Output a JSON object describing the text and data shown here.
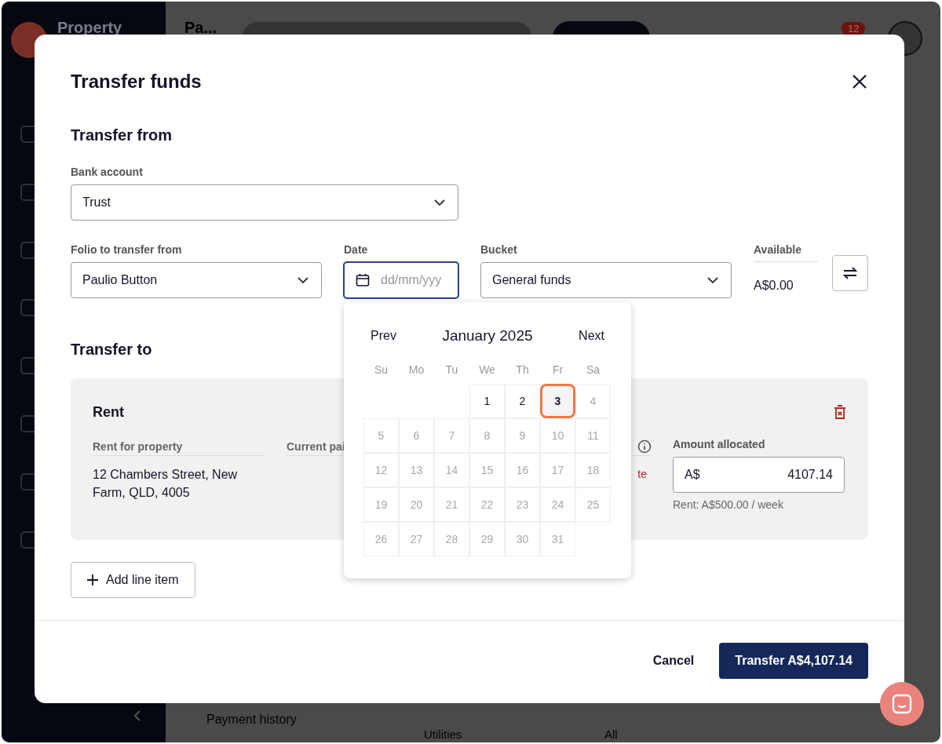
{
  "app": {
    "brand": "Property",
    "page_title": "Pa...",
    "notification_count": "12",
    "background_tab": "Payment history",
    "background_row": [
      "Utilities",
      "All"
    ]
  },
  "modal": {
    "title": "Transfer funds",
    "from": {
      "heading": "Transfer from",
      "bank_account": {
        "label": "Bank account",
        "value": "Trust"
      },
      "folio": {
        "label": "Folio to transfer from",
        "value": "Paulio Button"
      },
      "date": {
        "label": "Date",
        "placeholder": "dd/mm/yyy",
        "focused": true
      },
      "bucket": {
        "label": "Bucket",
        "value": "General funds"
      },
      "available": {
        "label": "Available",
        "value": "A$0.00"
      }
    },
    "to": {
      "heading": "Transfer to",
      "line_items": [
        {
          "title": "Rent",
          "property": {
            "label": "Rent for property",
            "value": "12 Chambers Street, New Farm, QLD, 4005"
          },
          "column_2": {
            "label": "Current pai",
            "status": "te"
          },
          "amount": {
            "label": "Amount allocated",
            "currency": "A$",
            "value": "4107.14",
            "hint": "Rent: A$500.00 / week"
          }
        }
      ],
      "add_button": "Add line item"
    },
    "footer": {
      "cancel": "Cancel",
      "submit": "Transfer A$4,107.14"
    }
  },
  "date_picker": {
    "prev": "Prev",
    "month": "January 2025",
    "next": "Next",
    "weekdays": [
      "Su",
      "Mo",
      "Tu",
      "We",
      "Th",
      "Fr",
      "Sa"
    ],
    "weeks": [
      [
        {
          "kind": "blank"
        },
        {
          "kind": "blank"
        },
        {
          "kind": "blank"
        },
        {
          "label": "1",
          "disabled": false,
          "selected": false
        },
        {
          "label": "2",
          "disabled": false,
          "selected": false
        },
        {
          "label": "3",
          "disabled": false,
          "selected": true
        },
        {
          "label": "4",
          "disabled": true,
          "selected": false
        }
      ],
      [
        {
          "label": "5",
          "disabled": true,
          "selected": false
        },
        {
          "label": "6",
          "disabled": true,
          "selected": false
        },
        {
          "label": "7",
          "disabled": true,
          "selected": false
        },
        {
          "label": "8",
          "disabled": true,
          "selected": false
        },
        {
          "label": "9",
          "disabled": true,
          "selected": false
        },
        {
          "label": "10",
          "disabled": true,
          "selected": false
        },
        {
          "label": "11",
          "disabled": true,
          "selected": false
        }
      ],
      [
        {
          "label": "12",
          "disabled": true,
          "selected": false
        },
        {
          "label": "13",
          "disabled": true,
          "selected": false
        },
        {
          "label": "14",
          "disabled": true,
          "selected": false
        },
        {
          "label": "15",
          "disabled": true,
          "selected": false
        },
        {
          "label": "16",
          "disabled": true,
          "selected": false
        },
        {
          "label": "17",
          "disabled": true,
          "selected": false
        },
        {
          "label": "18",
          "disabled": true,
          "selected": false
        }
      ],
      [
        {
          "label": "19",
          "disabled": true,
          "selected": false
        },
        {
          "label": "20",
          "disabled": true,
          "selected": false
        },
        {
          "label": "21",
          "disabled": true,
          "selected": false
        },
        {
          "label": "22",
          "disabled": true,
          "selected": false
        },
        {
          "label": "23",
          "disabled": true,
          "selected": false
        },
        {
          "label": "24",
          "disabled": true,
          "selected": false
        },
        {
          "label": "25",
          "disabled": true,
          "selected": false
        }
      ],
      [
        {
          "label": "26",
          "disabled": true,
          "selected": false
        },
        {
          "label": "27",
          "disabled": true,
          "selected": false
        },
        {
          "label": "28",
          "disabled": true,
          "selected": false
        },
        {
          "label": "29",
          "disabled": true,
          "selected": false
        },
        {
          "label": "30",
          "disabled": true,
          "selected": false
        },
        {
          "label": "31",
          "disabled": true,
          "selected": false
        },
        {
          "kind": "blank"
        }
      ]
    ]
  }
}
